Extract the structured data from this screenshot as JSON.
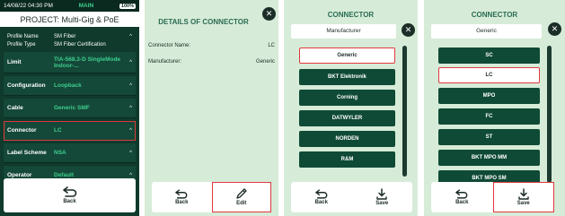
{
  "screen1": {
    "status": {
      "time": "14/08/22 04:30 PM",
      "mode": "MAIN",
      "battery": "100%"
    },
    "project_title": "PROJECT: Multi-Gig & PoE",
    "profile": [
      {
        "key": "Profile Name",
        "value": "SM Fiber"
      },
      {
        "key": "Profile Type",
        "value": "SM Fiber Certification"
      }
    ],
    "settings": [
      {
        "key": "Limit",
        "value": "TIA-568.3-D SingleMode Indoor-..."
      },
      {
        "key": "Configuration",
        "value": "Loopback"
      },
      {
        "key": "Cable",
        "value": "Generic SMF"
      },
      {
        "key": "Connector",
        "value": "LC"
      },
      {
        "key": "Label Scheme",
        "value": "NSA"
      },
      {
        "key": "Operator",
        "value": "Default"
      }
    ],
    "back_label": "Back"
  },
  "screen2": {
    "title": "DETAILS OF CONNECTOR",
    "details": [
      {
        "key": "Connector Name:",
        "value": "LC"
      },
      {
        "key": "Manufacturer:",
        "value": "Generic"
      }
    ],
    "back_label": "Back",
    "edit_label": "Edit"
  },
  "screen3": {
    "title": "CONNECTOR",
    "subheader": "Manufacturer",
    "items": [
      "Generic",
      "BKT Elektronik",
      "Corning",
      "DATWYLER",
      "NORDEN",
      "R&M"
    ],
    "selected_index": 0,
    "back_label": "Back",
    "save_label": "Save"
  },
  "screen4": {
    "title": "CONNECTOR",
    "subheader": "Generic",
    "items": [
      "SC",
      "LC",
      "MPO",
      "FC",
      "ST",
      "BKT MPO MM",
      "BKT MPO SM"
    ],
    "selected_index": 1,
    "back_label": "Back",
    "save_label": "Save"
  },
  "colors": {
    "accent_red": "#e0393e",
    "dark_green": "#0f4a36",
    "light_green_bg": "#d6ecd8",
    "value_green": "#3ecf8e"
  }
}
